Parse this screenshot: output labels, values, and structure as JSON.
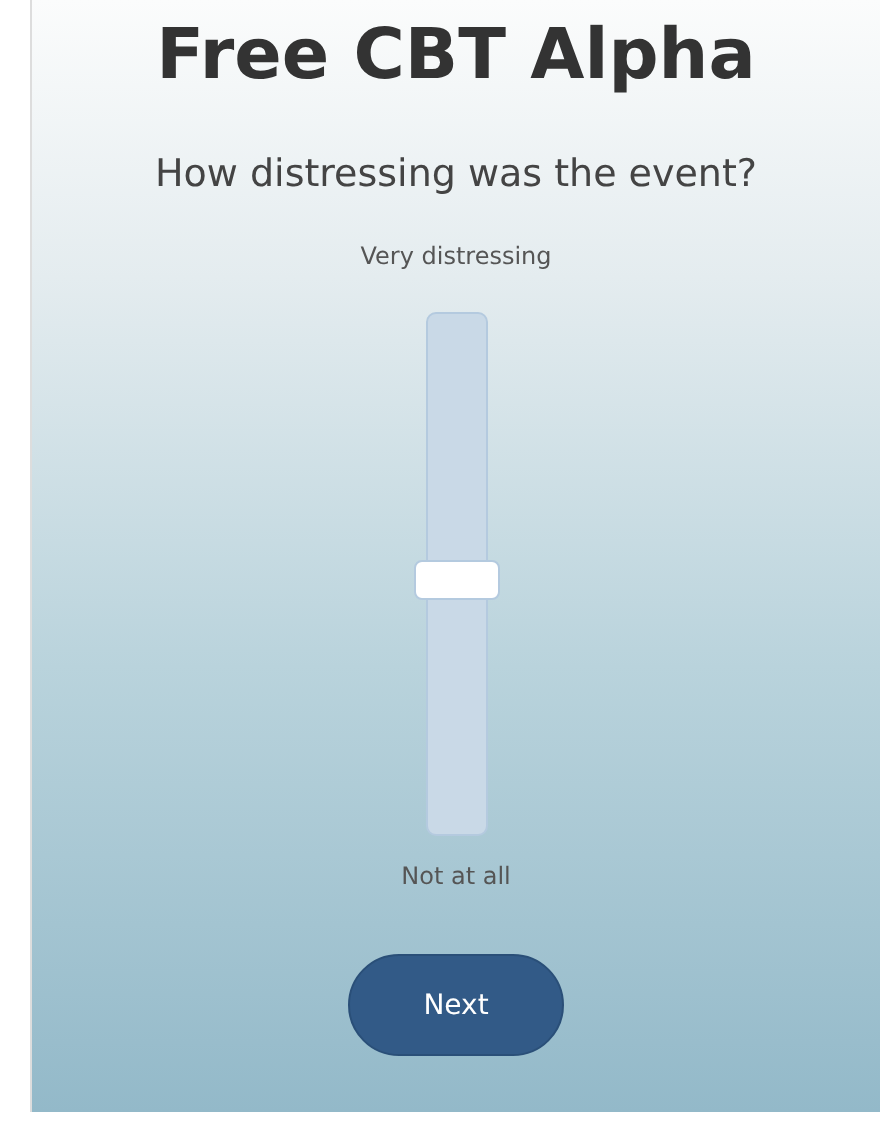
{
  "title": "Free CBT Alpha",
  "question": "How distressing was the event?",
  "slider": {
    "top_label": "Very distressing",
    "bottom_label": "Not at all",
    "level": 0.49
  },
  "button": {
    "label": "Next"
  }
}
